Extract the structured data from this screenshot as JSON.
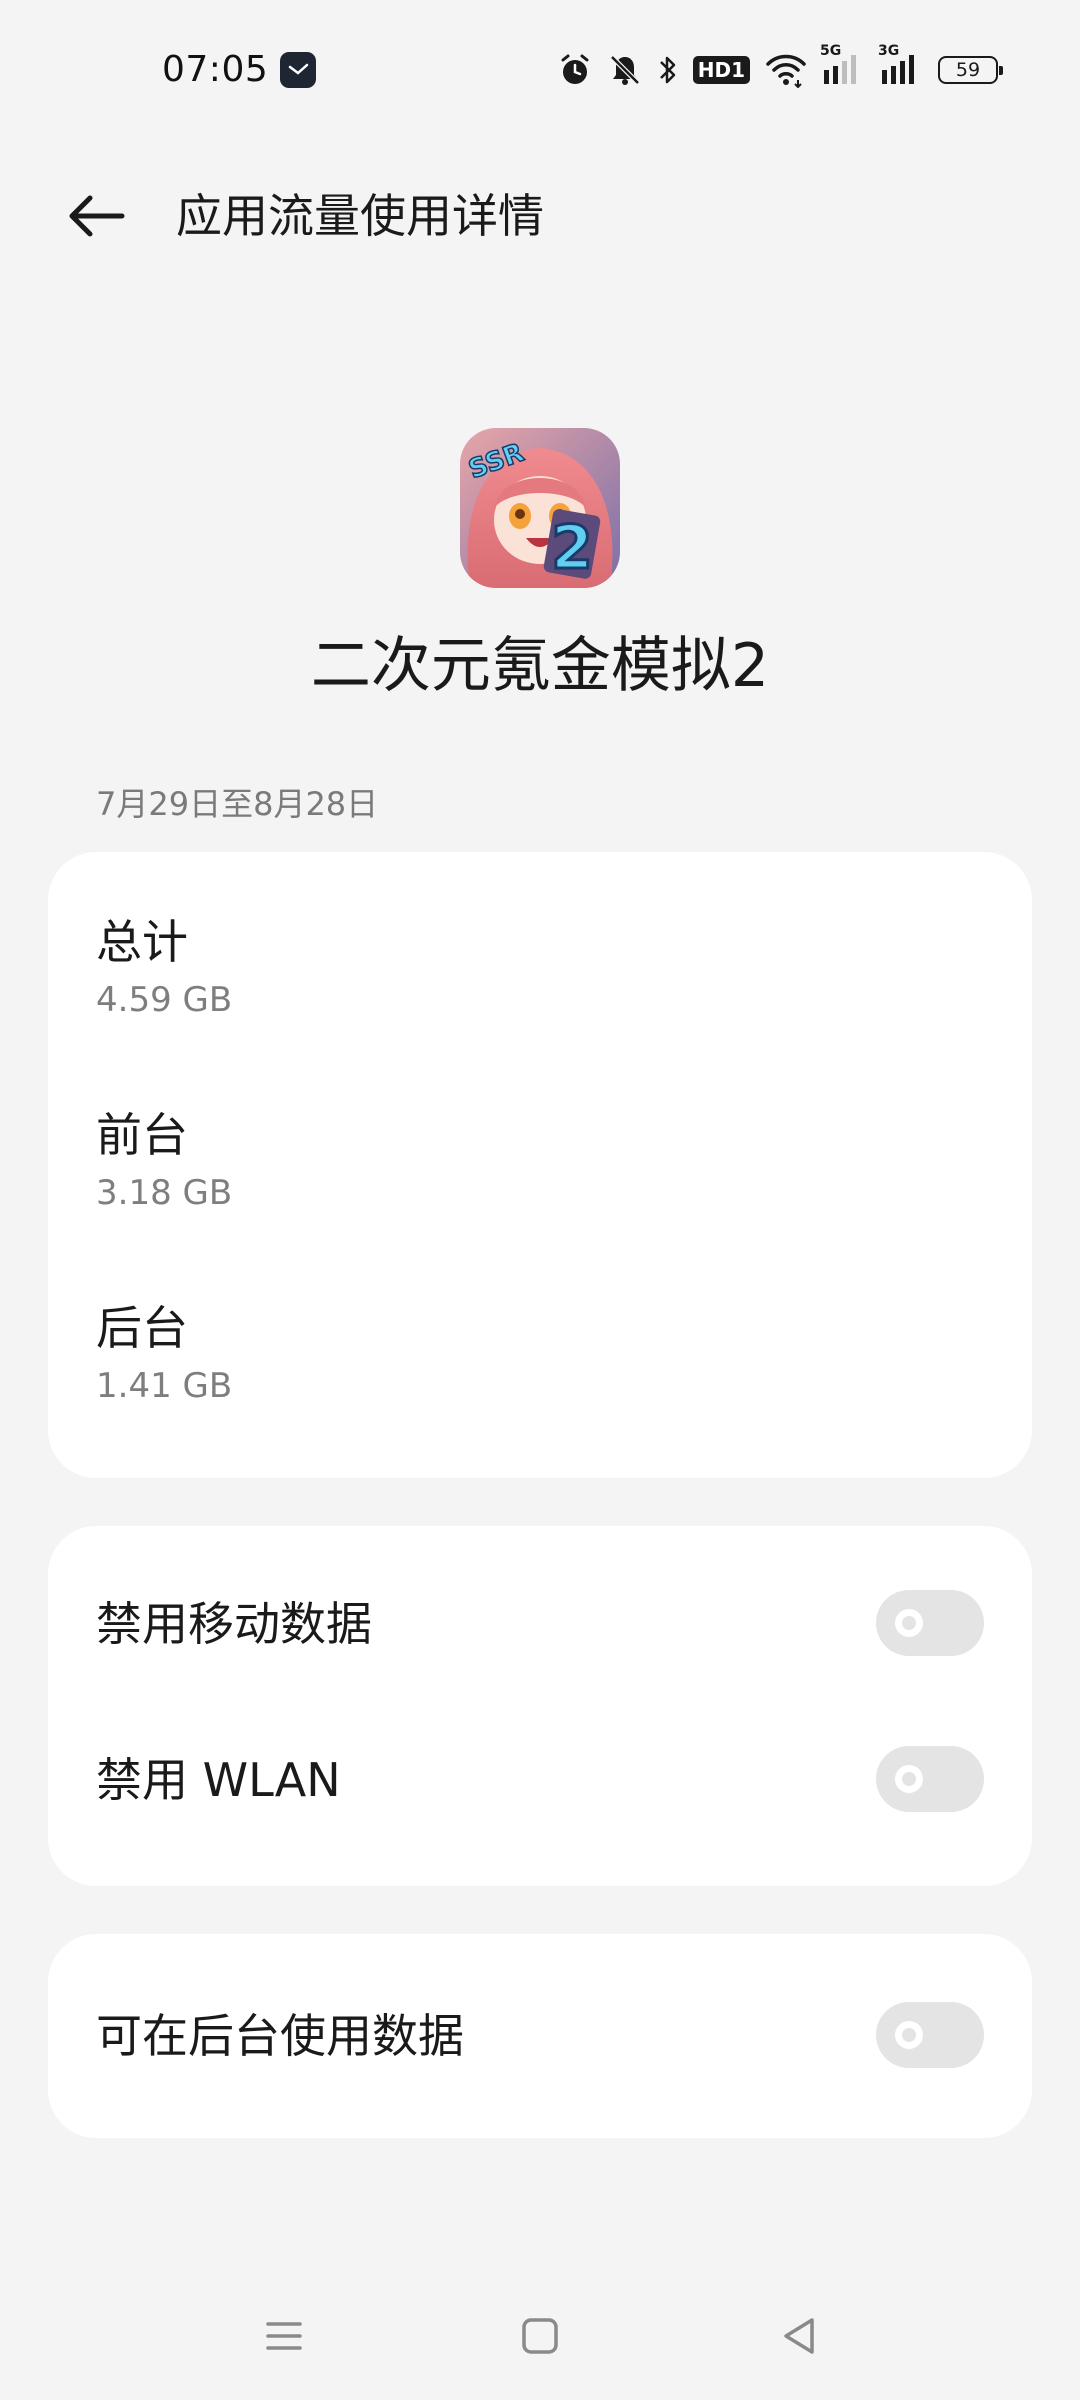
{
  "status_bar": {
    "time": "07:05",
    "battery_level": "59",
    "network_labels": [
      "5G",
      "3G"
    ],
    "hd_label": "HD1",
    "icons": [
      "clock-app-icon",
      "alarm-icon",
      "mute-icon",
      "bluetooth-icon",
      "hd-icon",
      "wifi-icon",
      "signal-5g-icon",
      "signal-3g-icon",
      "battery-icon"
    ]
  },
  "header": {
    "title": "应用流量使用详情",
    "back_icon": "back-arrow-icon"
  },
  "app": {
    "name": "二次元氪金模拟2",
    "icon": "app-icon"
  },
  "date_range": "7月29日至8月28日",
  "usage": {
    "total": {
      "label": "总计",
      "value": "4.59 GB"
    },
    "foreground": {
      "label": "前台",
      "value": "3.18 GB"
    },
    "background": {
      "label": "后台",
      "value": "1.41 GB"
    }
  },
  "restrictions": {
    "disable_mobile": {
      "label": "禁用移动数据",
      "enabled": false
    },
    "disable_wlan": {
      "label": "禁用 WLAN",
      "enabled": false
    }
  },
  "background_data": {
    "label": "可在后台使用数据",
    "enabled": false
  },
  "nav": {
    "icons": [
      "menu-icon",
      "home-icon",
      "back-icon"
    ]
  },
  "colors": {
    "background": "#f4f4f4",
    "card": "#ffffff",
    "toggle_off": "#e4e4e4",
    "secondary_text": "#7e7e7e"
  }
}
